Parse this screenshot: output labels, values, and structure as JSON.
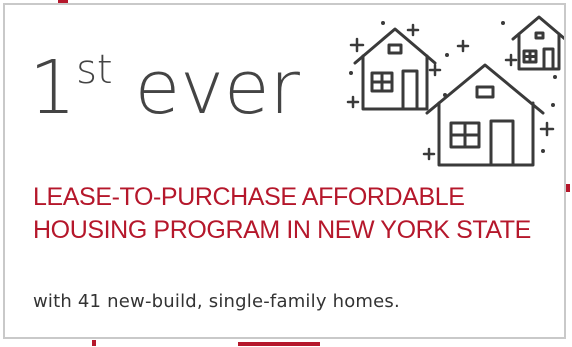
{
  "stat": {
    "number": "1",
    "suffix": "st",
    "word": "ever"
  },
  "headline": {
    "line1": "LEASE-TO-PURCHASE AFFORDABLE",
    "line2": "HOUSING PROGRAM IN NEW YORK STATE"
  },
  "subtext": "with 41 new-build, single-family homes.",
  "colors": {
    "accent": "#b5172b",
    "stat_text": "#444444",
    "body_text": "#333333",
    "border": "#c9c9c9",
    "icon_stroke": "#3a3a3a"
  },
  "icons": [
    "houses-with-sparkles-icon"
  ]
}
